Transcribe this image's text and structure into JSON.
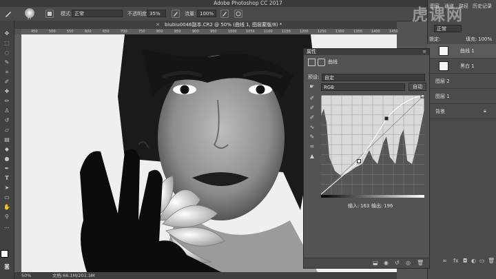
{
  "app": {
    "title": "Adobe Photoshop CC 2017"
  },
  "options_bar": {
    "brush_size": "35",
    "mode_label": "模式:",
    "mode_value": "正常",
    "opacity_label": "不透明度:",
    "opacity_value": "35%",
    "flow_label": "流量:",
    "flow_value": "100%"
  },
  "document": {
    "tab_title": "biubiu0046副本.CR2 @ 50% (曲线 1, 图层蒙版/8) *",
    "zoom": "50%",
    "doc_info": "文档:66.1M/201.1M"
  },
  "ruler_ticks": [
    "450",
    "500",
    "550",
    "600",
    "650",
    "700",
    "750",
    "800",
    "850",
    "900",
    "950",
    "1000",
    "1050",
    "1100",
    "1150",
    "1200",
    "1250",
    "1300",
    "1350",
    "1400",
    "1450"
  ],
  "right_panel": {
    "tabs": [
      "图层",
      "通道",
      "路径",
      "历史记录"
    ],
    "blend_label": "正常",
    "lock_label": "锁定:",
    "fill_label": "填充:",
    "fill_value": "100%",
    "layers": [
      {
        "name": "曲线 1"
      },
      {
        "name": "黑白 1"
      },
      {
        "name": "图层 2"
      },
      {
        "name": "图层 1"
      },
      {
        "name": "背景"
      }
    ]
  },
  "properties": {
    "title": "属性",
    "subtitle": "曲线",
    "preset_label": "预设:",
    "preset_value": "自定",
    "channel_value": "RGB",
    "auto_label": "自动",
    "input_label": "输入:",
    "input_value": "163",
    "output_label": "输出:",
    "output_value": "196"
  },
  "watermark": "虎课网",
  "colors": {
    "panel_bg": "#535353",
    "dark_bg": "#3a3a3a",
    "canvas_bg": "#f1f1f1"
  }
}
